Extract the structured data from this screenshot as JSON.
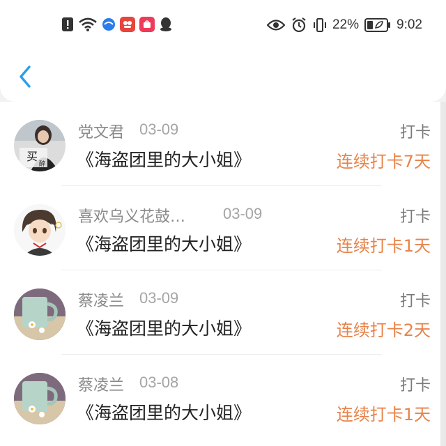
{
  "status_bar": {
    "battery_percent": "22%",
    "time": "9:02",
    "left_icons": [
      "alert-icon",
      "wifi-icon",
      "browser-icon",
      "app-icon",
      "shopping-icon",
      "qq-icon"
    ],
    "right_icons": [
      "eye-icon",
      "alarm-icon",
      "vibrate-icon",
      "battery-icon"
    ]
  },
  "nav": {
    "back_icon": "chevron-left-icon"
  },
  "colors": {
    "accent": "#2a9fe6",
    "streak": "#e8834a",
    "name": "#8a8a8a"
  },
  "entries": [
    {
      "name": "党文君",
      "date": "03-09",
      "book": "《海盗团里的大小姐》",
      "action": "打卡",
      "streak": "连续打卡7天",
      "avatar": "photo-avatar"
    },
    {
      "name": "喜欢乌义花鼓…",
      "date": "03-09",
      "book": "《海盗团里的大小姐》",
      "action": "打卡",
      "streak": "连续打卡1天",
      "avatar": "anime-avatar"
    },
    {
      "name": "蔡凌兰",
      "date": "03-09",
      "book": "《海盗团里的大小姐》",
      "action": "打卡",
      "streak": "连续打卡2天",
      "avatar": "mug-avatar"
    },
    {
      "name": "蔡凌兰",
      "date": "03-08",
      "book": "《海盗团里的大小姐》",
      "action": "打卡",
      "streak": "连续打卡1天",
      "avatar": "mug-avatar"
    }
  ]
}
